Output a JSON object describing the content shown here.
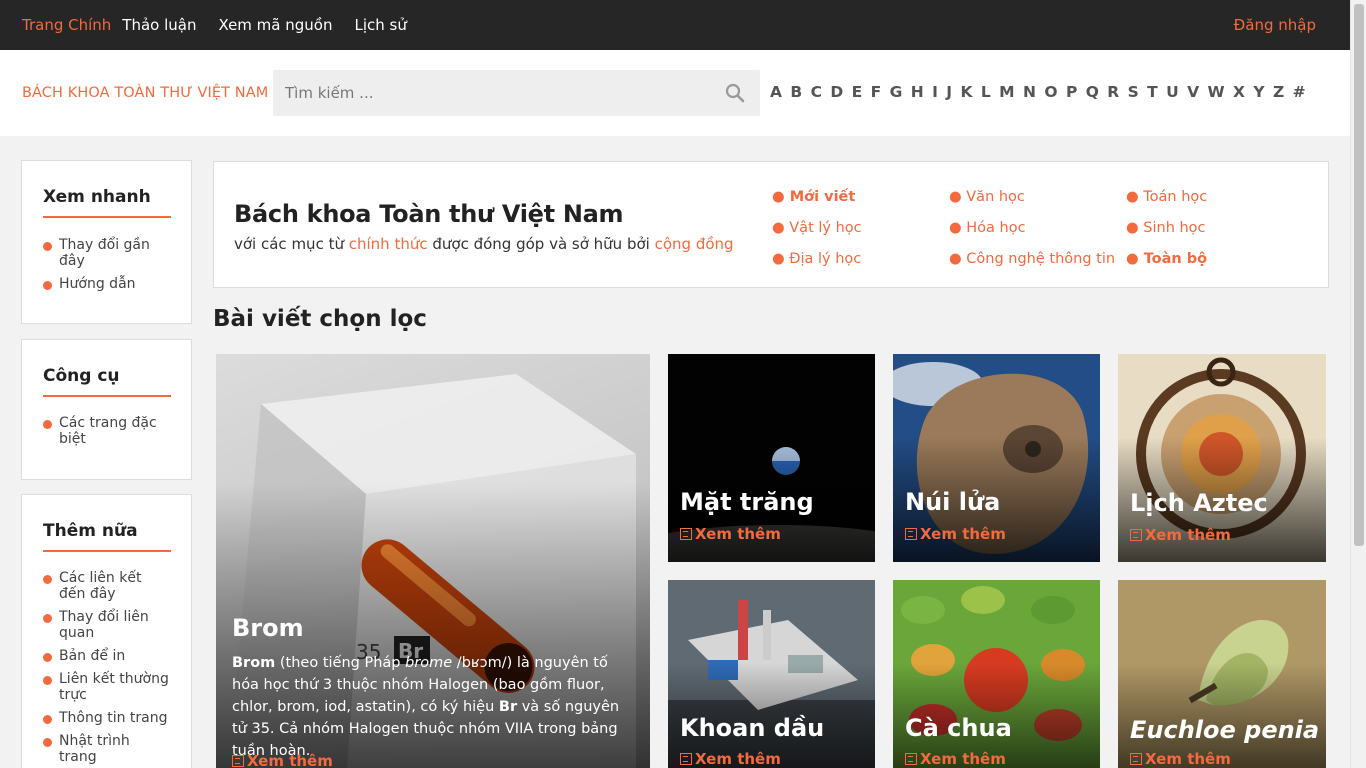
{
  "topnav": {
    "items": [
      {
        "label": "Trang Chính",
        "active": true
      },
      {
        "label": "Thảo luận"
      },
      {
        "label": "Xem mã nguồn"
      },
      {
        "label": "Lịch sử"
      }
    ],
    "login": "Đăng nhập"
  },
  "header": {
    "site_name": "BÁCH KHOA TOÀN THƯ VIỆT NAM",
    "search_placeholder": "Tìm kiếm ...",
    "search_icon": "search-icon",
    "alphabet": [
      "A",
      "B",
      "C",
      "D",
      "E",
      "F",
      "G",
      "H",
      "I",
      "J",
      "K",
      "L",
      "M",
      "N",
      "O",
      "P",
      "Q",
      "R",
      "S",
      "T",
      "U",
      "V",
      "W",
      "X",
      "Y",
      "Z",
      "#"
    ]
  },
  "sidebar": {
    "quick": {
      "title": "Xem nhanh",
      "items": [
        "Thay đổi gần đây",
        "Hướng dẫn"
      ]
    },
    "tools": {
      "title": "Công cụ",
      "items": [
        "Các trang đặc biệt"
      ]
    },
    "more": {
      "title": "Thêm nữa",
      "items": [
        "Các liên kết đến đây",
        "Thay đổi liên quan",
        "Bản để in",
        "Liên kết thường trực",
        "Thông tin trang",
        "Nhật trình trang"
      ]
    }
  },
  "intro": {
    "title": "Bách khoa Toàn thư Việt Nam",
    "sub_prefix": "với các mục từ ",
    "sub_link1": "chính thức",
    "sub_mid": " được đóng góp và sở hữu bởi ",
    "sub_link2": "cộng đồng",
    "categories": [
      "Mới viết",
      "Văn học",
      "Toán học",
      "Vật lý học",
      "Hóa học",
      "Sinh học",
      "Địa lý học",
      "Công nghệ thông tin",
      "Toàn bộ"
    ]
  },
  "featured": {
    "title": "Bài viết chọn lọc",
    "more_label": "Xem thêm",
    "main": {
      "name": "Brom",
      "desc_b1": "Brom",
      "desc_t1": " (theo tiếng Pháp ",
      "desc_i1": "brome",
      "desc_t2": " /bʁɔm/) là nguyên tố hóa học thứ 3 thuộc nhóm Halogen (bao gồm fluor, chlor, brom, iod, astatin), có ký hiệu ",
      "desc_b2": "Br",
      "desc_t3": " và số nguyên tử 35. Cả nhóm Halogen thuộc nhóm VIIA trong bảng tuần hoàn."
    },
    "tiles": [
      "Mặt trăng",
      "Núi lửa",
      "Lịch Aztec",
      "Khoan dầu",
      "Cà chua",
      "Euchloe penia"
    ]
  },
  "colors": {
    "accent": "#f26a3d",
    "topbar": "#262626"
  }
}
